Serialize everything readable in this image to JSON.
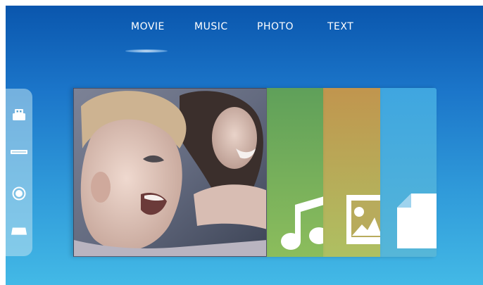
{
  "tabs": [
    {
      "label": "MOVIE",
      "selected": true
    },
    {
      "label": "MUSIC",
      "selected": false
    },
    {
      "label": "PHOTO",
      "selected": false
    },
    {
      "label": "TEXT",
      "selected": false
    }
  ],
  "sidebar": {
    "icons": [
      "usb-drive-icon",
      "dvd-drive-icon",
      "disc-icon",
      "hard-drive-icon"
    ]
  },
  "cards": [
    {
      "category": "movie",
      "thumbnail": "family-photo-thumbnail"
    },
    {
      "category": "music",
      "icon": "music-note-icon",
      "color": "#6faa5b"
    },
    {
      "category": "photo",
      "icon": "image-icon",
      "color": "#c1954e"
    },
    {
      "category": "text",
      "icon": "document-icon",
      "color": "#49aee0"
    }
  ],
  "colors": {
    "background_top": "#0a56ad",
    "background_bottom": "#43b9e6",
    "tab_text": "#ffffff"
  }
}
